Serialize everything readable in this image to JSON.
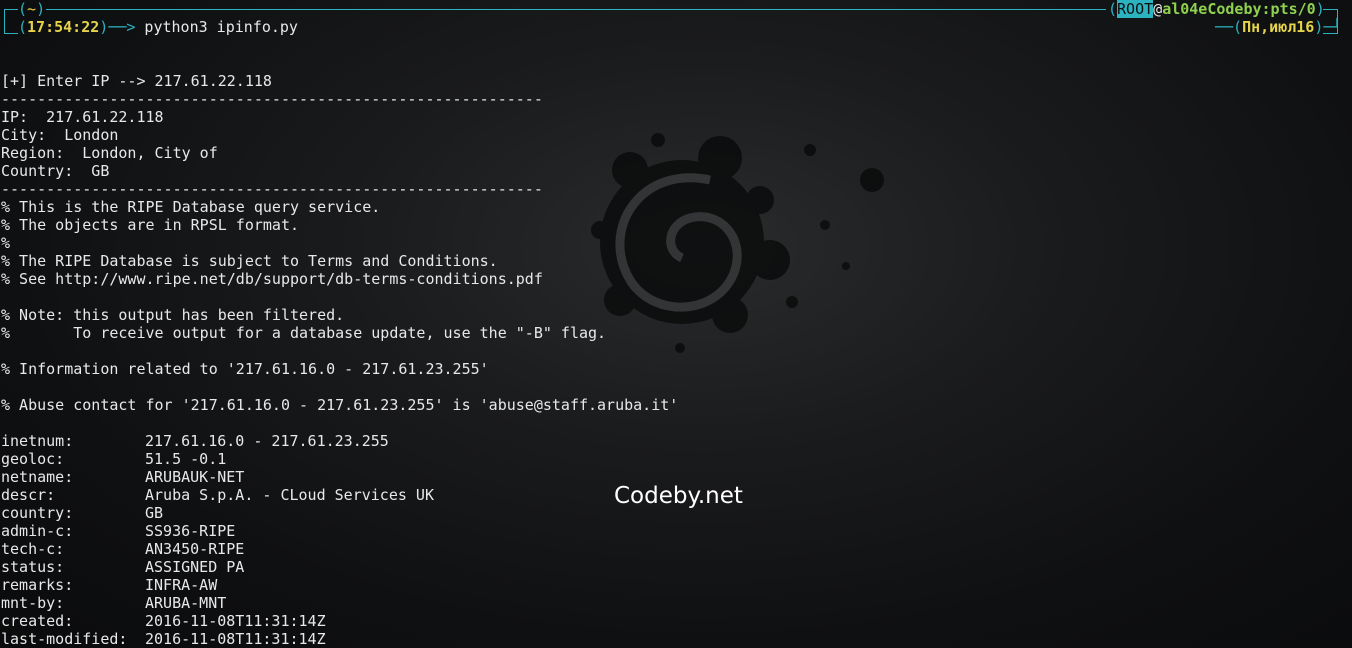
{
  "prompt": {
    "left_top": "(~)",
    "time_open": "(",
    "time": "17:54:22",
    "time_close": ")",
    "arrow": "──>",
    "command": " python3 ipinfo.py",
    "root_label": "ROOT",
    "host_at": "@",
    "host": "al04eCodeby:pts/0",
    "date": "Пн,июл16",
    "colors": {
      "frame": "#2bb3c0",
      "time": "#e5d34a",
      "host": "#8fd14f"
    }
  },
  "output_lines": [
    "[+] Enter IP --> 217.61.22.118",
    "------------------------------------------------------------",
    "IP:  217.61.22.118",
    "City:  London",
    "Region:  London, City of",
    "Country:  GB",
    "------------------------------------------------------------",
    "% This is the RIPE Database query service.",
    "% The objects are in RPSL format.",
    "%",
    "% The RIPE Database is subject to Terms and Conditions.",
    "% See http://www.ripe.net/db/support/db-terms-conditions.pdf",
    "",
    "% Note: this output has been filtered.",
    "%       To receive output for a database update, use the \"-B\" flag.",
    "",
    "% Information related to '217.61.16.0 - 217.61.23.255'",
    "",
    "% Abuse contact for '217.61.16.0 - 217.61.23.255' is 'abuse@staff.aruba.it'",
    ""
  ],
  "whois_fields": [
    {
      "key": "inetnum:",
      "value": "217.61.16.0 - 217.61.23.255"
    },
    {
      "key": "geoloc:",
      "value": "51.5 -0.1"
    },
    {
      "key": "netname:",
      "value": "ARUBAUK-NET"
    },
    {
      "key": "descr:",
      "value": "Aruba S.p.A. - CLoud Services UK"
    },
    {
      "key": "country:",
      "value": "GB"
    },
    {
      "key": "admin-c:",
      "value": "SS936-RIPE"
    },
    {
      "key": "tech-c:",
      "value": "AN3450-RIPE"
    },
    {
      "key": "status:",
      "value": "ASSIGNED PA"
    },
    {
      "key": "remarks:",
      "value": "INFRA-AW"
    },
    {
      "key": "mnt-by:",
      "value": "ARUBA-MNT"
    },
    {
      "key": "created:",
      "value": "2016-11-08T11:31:14Z"
    },
    {
      "key": "last-modified:",
      "value": "2016-11-08T11:31:14Z"
    }
  ],
  "watermark": "Codeby.net",
  "background_icon": "debian-swirl-icon"
}
